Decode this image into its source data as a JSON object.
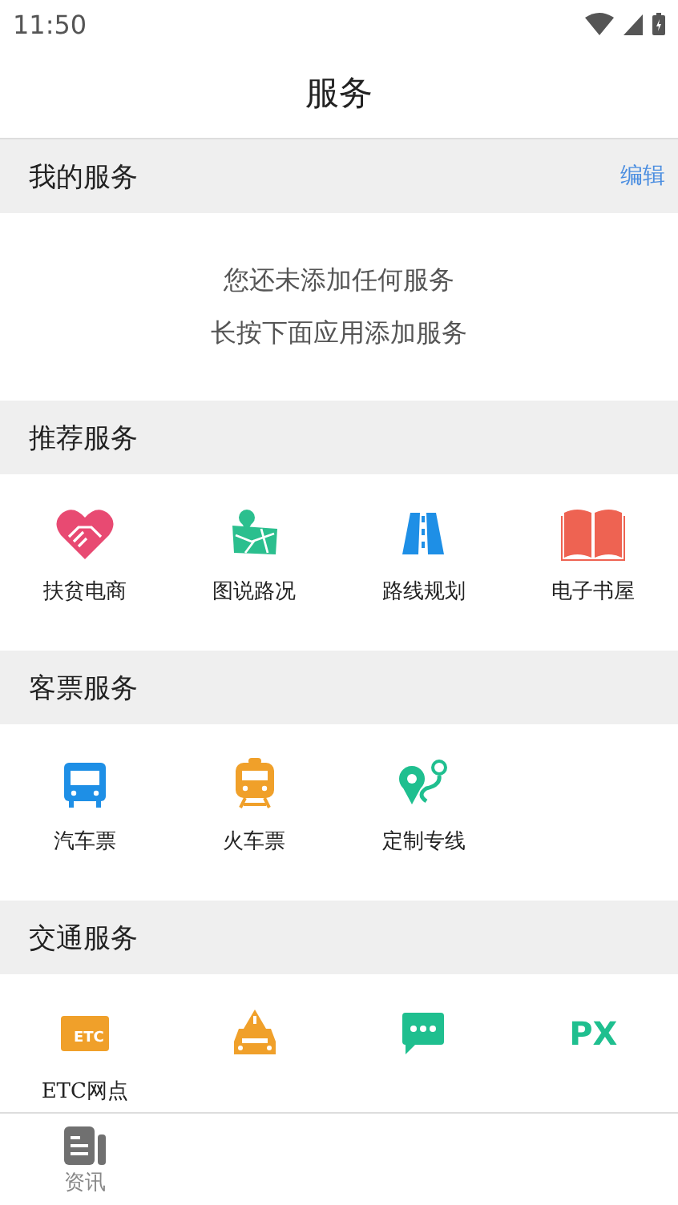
{
  "status_bar": {
    "time": "11:50"
  },
  "header": {
    "title": "服务"
  },
  "my_services": {
    "title": "我的服务",
    "edit": "编辑",
    "empty_lines": [
      "您还未添加任何服务",
      "长按下面应用添加服务"
    ]
  },
  "sections": [
    {
      "title": "推荐服务",
      "items": [
        {
          "kind": "handshake",
          "label": "扶贫电商"
        },
        {
          "kind": "map",
          "label": "图说路况"
        },
        {
          "kind": "road",
          "label": "路线规划"
        },
        {
          "kind": "book",
          "label": "电子书屋"
        }
      ]
    },
    {
      "title": "客票服务",
      "items": [
        {
          "kind": "bus",
          "label": "汽车票"
        },
        {
          "kind": "train",
          "label": "火车票"
        },
        {
          "kind": "route",
          "label": "定制专线"
        }
      ]
    },
    {
      "title": "交通服务",
      "items": [
        {
          "kind": "etc",
          "label": "ETC网点",
          "icon_text": "ETC"
        },
        {
          "kind": "taxi"
        },
        {
          "kind": "chat"
        },
        {
          "kind": "px",
          "icon_text": "PX"
        }
      ]
    }
  ],
  "tabs": [
    {
      "kind": "news",
      "label": "资讯",
      "selected": false
    }
  ]
}
